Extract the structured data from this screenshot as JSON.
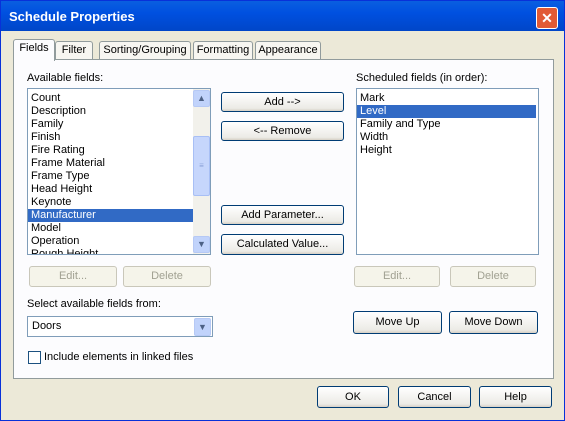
{
  "window": {
    "title": "Schedule Properties",
    "close_glyph": "✕"
  },
  "tabs": [
    {
      "label": "Fields",
      "active": true
    },
    {
      "label": "Filter"
    },
    {
      "label": "Sorting/Grouping"
    },
    {
      "label": "Formatting"
    },
    {
      "label": "Appearance"
    }
  ],
  "available": {
    "label": "Available fields:",
    "items": [
      "Count",
      "Description",
      "Family",
      "Finish",
      "Fire Rating",
      "Frame Material",
      "Frame Type",
      "Head Height",
      "Keynote",
      "Manufacturer",
      "Model",
      "Operation",
      "Rough Height"
    ],
    "selected": "Manufacturer",
    "edit_label": "Edit...",
    "delete_label": "Delete"
  },
  "scheduled": {
    "label": "Scheduled fields (in order):",
    "items": [
      "Mark",
      "Level",
      "Family and Type",
      "Width",
      "Height"
    ],
    "selected": "Level",
    "edit_label": "Edit...",
    "delete_label": "Delete"
  },
  "middle": {
    "add_label": "Add -->",
    "remove_label": "<-- Remove",
    "add_parameter_label": "Add Parameter...",
    "calculated_value_label": "Calculated Value..."
  },
  "move": {
    "up_label": "Move Up",
    "down_label": "Move Down"
  },
  "source": {
    "label": "Select available fields from:",
    "value": "Doors"
  },
  "linked": {
    "label": "Include elements in linked files",
    "checked": false
  },
  "footer": {
    "ok_label": "OK",
    "cancel_label": "Cancel",
    "help_label": "Help"
  },
  "icons": {
    "scroll_up": "▲",
    "scroll_down": "▼",
    "thumb_grip": "≡",
    "combo_arrow": "▼"
  },
  "colors": {
    "title_bar": "#0050e0",
    "selection": "#316ac5",
    "close": "#e15a35"
  }
}
